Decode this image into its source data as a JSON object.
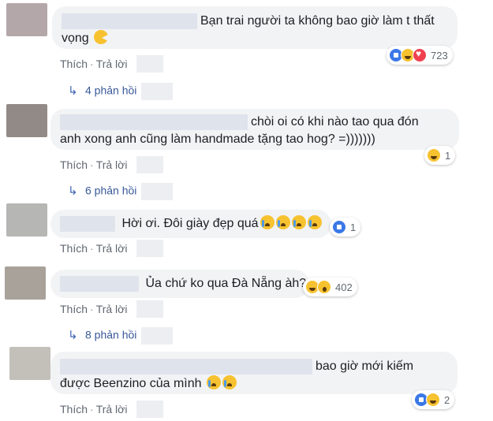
{
  "labels": {
    "like": "Thích",
    "reply": "Trả lời",
    "dot": "·"
  },
  "comments": [
    {
      "lines": [
        "Bạn trai người ta không bao giờ làm t thất",
        "vọng"
      ],
      "reaction_count": "723",
      "replies": "4 phản hồi",
      "avatar_color": "#b4a7a9"
    },
    {
      "lines": [
        "chòi oi có khi nào tao qua đón",
        "anh xong anh cũng làm handmade tặng tao hog? =)))))))"
      ],
      "reaction_count": "1",
      "replies": "6 phản hồi",
      "avatar_color": "#928a86"
    },
    {
      "lines": [
        "Hời ơi. Đôi giày đẹp quá"
      ],
      "reaction_count": "1",
      "replies": "",
      "avatar_color": "#b6b6b4"
    },
    {
      "lines": [
        "Ủa chứ ko qua Đà Nẵng àh?"
      ],
      "reaction_count": "402",
      "replies": "8 phản hồi",
      "avatar_color": "#a8a29a"
    },
    {
      "lines": [
        "bao giờ mới kiếm",
        "được Beenzino của mình"
      ],
      "reaction_count": "2",
      "replies": "",
      "avatar_color": "#c3bfb9"
    }
  ],
  "reaction_icons": [
    "like-reaction-icon",
    "haha-reaction-icon",
    "love-reaction-icon",
    "wow-reaction-icon"
  ],
  "colors": {
    "bubble": "#f2f3f5",
    "link": "#385898",
    "meta": "#616770",
    "like": "#3b78e7",
    "haha": "#f7c230",
    "love": "#f0404f"
  }
}
